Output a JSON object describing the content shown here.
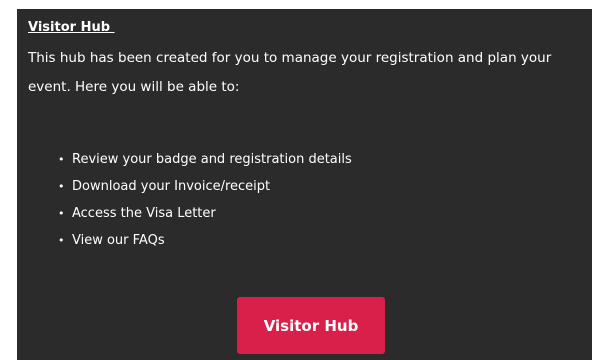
{
  "hub": {
    "title": "Visitor Hub ",
    "intro": "This hub has been created for you to manage your registration and plan your event. Here you will be able to:",
    "bullet_glyph": "•",
    "items": [
      "Review your badge and registration details",
      "Download your Invoice/receipt",
      "Access the Visa Letter",
      "View our FAQs"
    ],
    "button_label": "Visitor Hub"
  },
  "colors": {
    "panel_background": "#2b2b2b",
    "button_background": "#d8204a",
    "text": "#ffffff"
  }
}
